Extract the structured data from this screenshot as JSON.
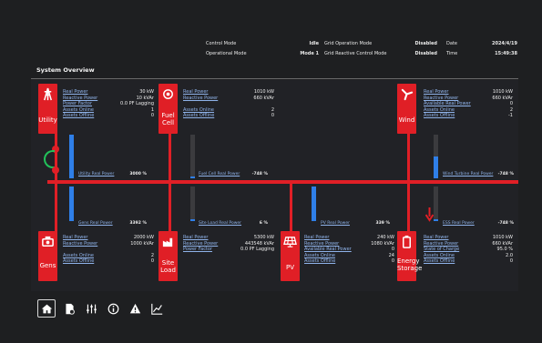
{
  "header": {
    "row1": {
      "left_label": "Control Mode",
      "left_value": "Idle",
      "mid_label": "Grid Operation Mode",
      "mid_value": "Disabled",
      "right_label": "Date",
      "right_value": "2024/4/19"
    },
    "row2": {
      "left_label": "Operational Mode",
      "left_value": "Mode 1",
      "mid_label": "Grid Reactive Control Mode",
      "mid_value": "Disabled",
      "right_label": "Time",
      "right_value": "15:49:38"
    }
  },
  "section_title": "System Overview",
  "utility": {
    "label": "Utility",
    "rows": [
      {
        "k": "Real Power",
        "v": "30 kW"
      },
      {
        "k": "Reactive Power",
        "v": "10 kVAr"
      },
      {
        "k": "Power Factor",
        "v": "0.0 PF Lagging"
      },
      {
        "k": "Assets Online",
        "v": "1"
      },
      {
        "k": "Assets Offline",
        "v": "0"
      }
    ],
    "bar_label": "Utility Real Power",
    "bar_value": "3000 %",
    "fill": 1.0
  },
  "fuelcell": {
    "label1": "Fuel",
    "label2": "Cell",
    "rows": [
      {
        "k": "Real Power",
        "v": "1010 kW"
      },
      {
        "k": "Reactive Power",
        "v": "660 kVAr"
      },
      {
        "k": "",
        "v": ""
      },
      {
        "k": "Assets Online",
        "v": "2"
      },
      {
        "k": "Assets Offline",
        "v": "0"
      }
    ],
    "bar_label": "Fuel Cell Real Power",
    "bar_value": "-748 %",
    "fill": 0.05
  },
  "wind": {
    "label": "Wind",
    "rows": [
      {
        "k": "Real Power",
        "v": "1010 kW"
      },
      {
        "k": "Reactive Power",
        "v": "660 kVAr"
      },
      {
        "k": "Available Real Power",
        "v": "0"
      },
      {
        "k": "Assets Online",
        "v": "2"
      },
      {
        "k": "Assets Offline",
        "v": "-1"
      }
    ],
    "bar_label": "Wind Turbine Real Power",
    "bar_value": "-748 %",
    "fill": 0.5
  },
  "gens": {
    "label": "Gens",
    "rows": [
      {
        "k": "Real Power",
        "v": "2000 kW"
      },
      {
        "k": "Reactive Power",
        "v": "1000 kVAr"
      },
      {
        "k": "",
        "v": ""
      },
      {
        "k": "Assets Online",
        "v": "2"
      },
      {
        "k": "Assets Offline",
        "v": "0"
      }
    ],
    "bar_label": "Gens Real Power",
    "bar_value": "3392 %",
    "fill": 1.0
  },
  "siteload": {
    "label1": "Site",
    "label2": "Load",
    "rows": [
      {
        "k": "Real Power",
        "v": "5300 kW"
      },
      {
        "k": "Reactive Power",
        "v": "443548 kVAr"
      },
      {
        "k": "Power Factor",
        "v": "0.0 PF Lagging"
      }
    ],
    "bar_label": "Site Load Real Power",
    "bar_value": "6 %",
    "fill": 0.05
  },
  "pv": {
    "label": "PV",
    "rows": [
      {
        "k": "Real Power",
        "v": "240 kW"
      },
      {
        "k": "Reactive Power",
        "v": "1080 kVAr"
      },
      {
        "k": "Available Real Power",
        "v": "0"
      },
      {
        "k": "Assets Online",
        "v": "24"
      },
      {
        "k": "Assets Offline",
        "v": "0"
      }
    ],
    "bar_label": "PV Real Power",
    "bar_value": "339 %",
    "fill": 1.0
  },
  "ess": {
    "label1": "Energy",
    "label2": "Storage",
    "rows": [
      {
        "k": "Real Power",
        "v": "1010 kW"
      },
      {
        "k": "Reactive Power",
        "v": "660 kVAr"
      },
      {
        "k": "State of Charge",
        "v": "95.0 %"
      },
      {
        "k": "Assets Online",
        "v": "2.0"
      },
      {
        "k": "Assets Offline",
        "v": "0"
      }
    ],
    "bar_label": "ESS Real Power",
    "bar_value": "-748 %",
    "fill": 0.05
  },
  "colors": {
    "accent": "#e01f26",
    "bar": "#2f7fe8",
    "link": "#8fb3ea",
    "breaker": "#22c25a"
  },
  "toolbar": {
    "items": [
      "home-icon",
      "report-icon",
      "sliders-icon",
      "info-icon",
      "warning-icon",
      "chart-icon"
    ]
  }
}
